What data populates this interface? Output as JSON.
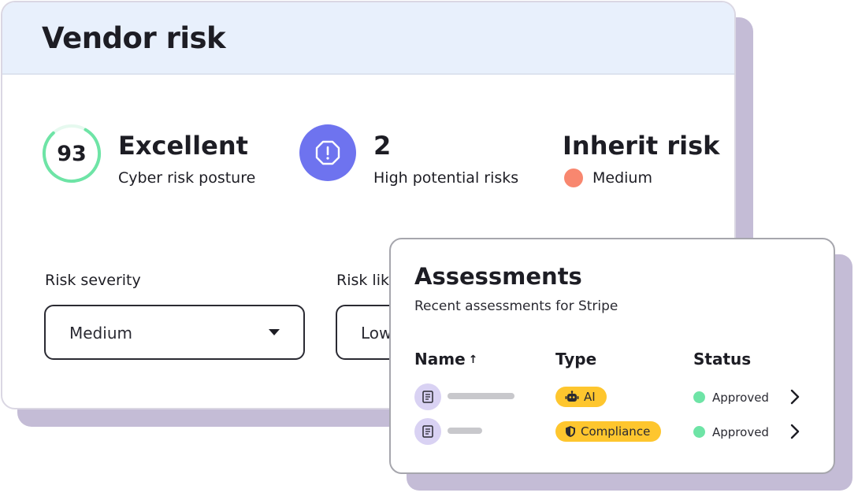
{
  "vendor_card": {
    "title": "Vendor risk",
    "score": {
      "value": "93",
      "label": "Excellent",
      "caption": "Cyber risk posture",
      "ring_color": "#6ee4a6",
      "ring_fill": 0.8
    },
    "risks": {
      "value": "2",
      "caption": "High potential risks",
      "icon": "alert-octagon-icon",
      "color": "#6e73ef"
    },
    "inherit": {
      "title": "Inherit risk",
      "level": "Medium",
      "dot_color": "#f8876f"
    },
    "fields": {
      "severity_label": "Risk severity",
      "severity_value": "Medium",
      "likelihood_label": "Risk like",
      "likelihood_value": "Low"
    }
  },
  "assessments": {
    "title": "Assessments",
    "subtitle": "Recent assessments for Stripe",
    "columns": {
      "name": "Name",
      "name_sort_icon": "↑",
      "type": "Type",
      "status": "Status"
    },
    "rows": [
      {
        "type": "AI",
        "type_icon": "robot-icon",
        "status": "Approved"
      },
      {
        "type": "Compliance",
        "type_icon": "shield-icon",
        "status": "Approved"
      }
    ]
  },
  "colors": {
    "accent": "#6e73ef",
    "pill": "#fec62e",
    "approved": "#6ee4a6",
    "shadow": "#c4bcd6",
    "header_bg": "#e8f0fc"
  }
}
